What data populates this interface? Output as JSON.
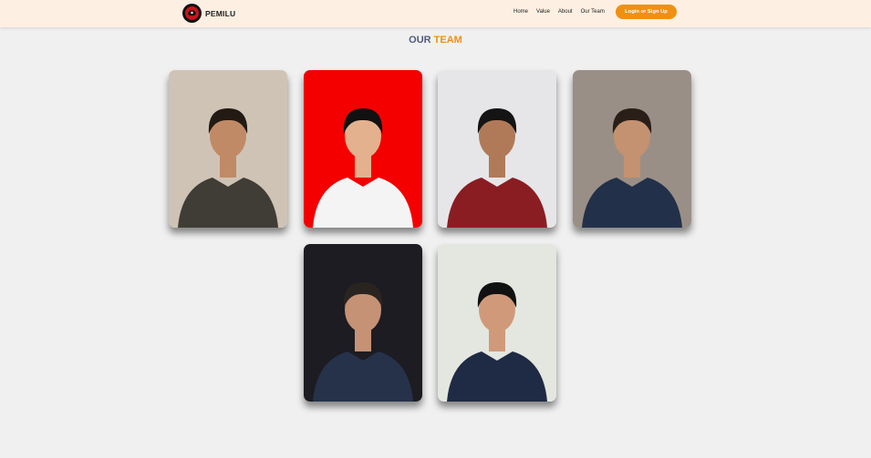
{
  "brand": {
    "name": "PEMILU",
    "logo_icon": "party-emblem-icon"
  },
  "nav": {
    "links": [
      "Home",
      "Value",
      "About",
      "Our Team"
    ],
    "login_label": "Login or Sign Up"
  },
  "section": {
    "title_part1": "OUR",
    "title_part2": "TEAM"
  },
  "team": {
    "photos": [
      {
        "background": "#cfc3b5",
        "shirt": "#3f3d35",
        "skin": "#c18a66",
        "hair": "#241a14"
      },
      {
        "background": "#f40000",
        "shirt": "#f4f4f4",
        "skin": "#e4b18e",
        "hair": "#111111"
      },
      {
        "background": "#e6e6e8",
        "shirt": "#8a1d22",
        "skin": "#b07a58",
        "hair": "#141414"
      },
      {
        "background": "#9a8f86",
        "shirt": "#23304a",
        "skin": "#c49270",
        "hair": "#2a1f18"
      },
      {
        "background": "#1c1c22",
        "shirt": "#26324a",
        "skin": "#c59275",
        "hair": "#2a2420"
      },
      {
        "background": "#e3e7df",
        "shirt": "#1f2a44",
        "skin": "#d09a7a",
        "hair": "#111111"
      }
    ]
  },
  "colors": {
    "accent": "#f0900f",
    "title_dark": "#525c7c",
    "navbar_bg": "#fdf0e2",
    "page_bg": "#f0f0f0"
  }
}
